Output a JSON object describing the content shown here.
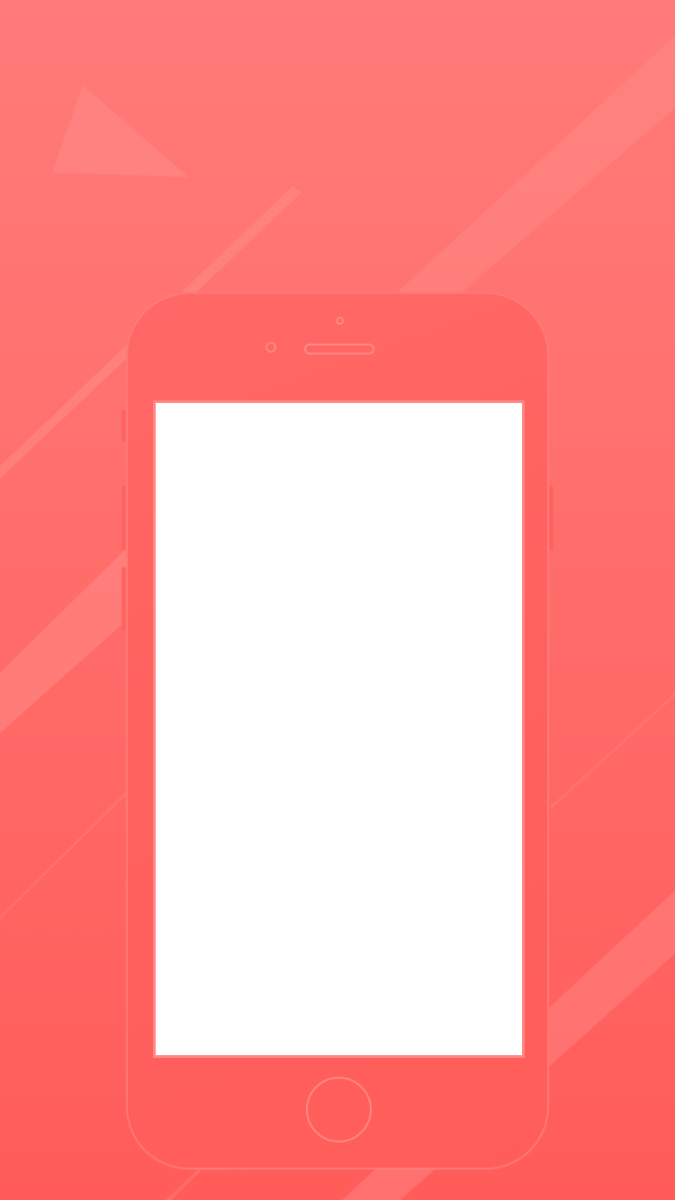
{
  "colors": {
    "background_top": "#ff7b79",
    "background_bottom": "#ff5c5a",
    "phone_body": "#ff625f",
    "phone_outline": "#ff8c87",
    "screen": "#ffffff",
    "screen_border": "#ff8784"
  },
  "icons": {
    "home_button": "home-button-circle",
    "camera": "front-camera-circle",
    "speaker": "earpiece-speaker-slot"
  }
}
